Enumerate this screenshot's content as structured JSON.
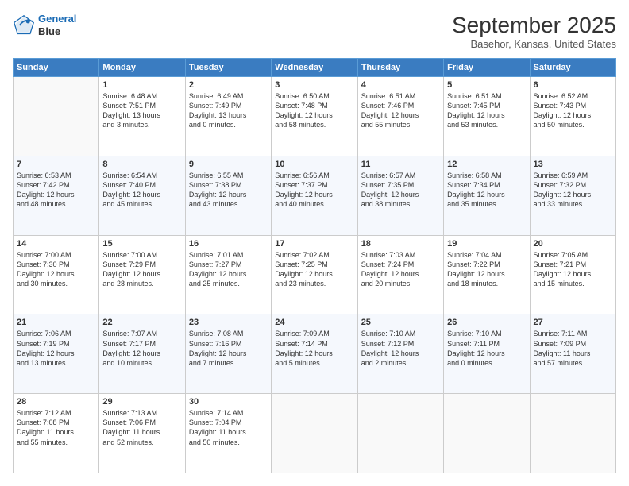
{
  "app": {
    "name": "GeneralBlue",
    "logo_line1": "General",
    "logo_line2": "Blue"
  },
  "header": {
    "month": "September 2025",
    "location": "Basehor, Kansas, United States"
  },
  "weekdays": [
    "Sunday",
    "Monday",
    "Tuesday",
    "Wednesday",
    "Thursday",
    "Friday",
    "Saturday"
  ],
  "weeks": [
    [
      {
        "day": "",
        "sunrise": "",
        "sunset": "",
        "daylight": ""
      },
      {
        "day": "1",
        "sunrise": "Sunrise: 6:48 AM",
        "sunset": "Sunset: 7:51 PM",
        "daylight": "Daylight: 13 hours and 3 minutes."
      },
      {
        "day": "2",
        "sunrise": "Sunrise: 6:49 AM",
        "sunset": "Sunset: 7:49 PM",
        "daylight": "Daylight: 13 hours and 0 minutes."
      },
      {
        "day": "3",
        "sunrise": "Sunrise: 6:50 AM",
        "sunset": "Sunset: 7:48 PM",
        "daylight": "Daylight: 12 hours and 58 minutes."
      },
      {
        "day": "4",
        "sunrise": "Sunrise: 6:51 AM",
        "sunset": "Sunset: 7:46 PM",
        "daylight": "Daylight: 12 hours and 55 minutes."
      },
      {
        "day": "5",
        "sunrise": "Sunrise: 6:51 AM",
        "sunset": "Sunset: 7:45 PM",
        "daylight": "Daylight: 12 hours and 53 minutes."
      },
      {
        "day": "6",
        "sunrise": "Sunrise: 6:52 AM",
        "sunset": "Sunset: 7:43 PM",
        "daylight": "Daylight: 12 hours and 50 minutes."
      }
    ],
    [
      {
        "day": "7",
        "sunrise": "Sunrise: 6:53 AM",
        "sunset": "Sunset: 7:42 PM",
        "daylight": "Daylight: 12 hours and 48 minutes."
      },
      {
        "day": "8",
        "sunrise": "Sunrise: 6:54 AM",
        "sunset": "Sunset: 7:40 PM",
        "daylight": "Daylight: 12 hours and 45 minutes."
      },
      {
        "day": "9",
        "sunrise": "Sunrise: 6:55 AM",
        "sunset": "Sunset: 7:38 PM",
        "daylight": "Daylight: 12 hours and 43 minutes."
      },
      {
        "day": "10",
        "sunrise": "Sunrise: 6:56 AM",
        "sunset": "Sunset: 7:37 PM",
        "daylight": "Daylight: 12 hours and 40 minutes."
      },
      {
        "day": "11",
        "sunrise": "Sunrise: 6:57 AM",
        "sunset": "Sunset: 7:35 PM",
        "daylight": "Daylight: 12 hours and 38 minutes."
      },
      {
        "day": "12",
        "sunrise": "Sunrise: 6:58 AM",
        "sunset": "Sunset: 7:34 PM",
        "daylight": "Daylight: 12 hours and 35 minutes."
      },
      {
        "day": "13",
        "sunrise": "Sunrise: 6:59 AM",
        "sunset": "Sunset: 7:32 PM",
        "daylight": "Daylight: 12 hours and 33 minutes."
      }
    ],
    [
      {
        "day": "14",
        "sunrise": "Sunrise: 7:00 AM",
        "sunset": "Sunset: 7:30 PM",
        "daylight": "Daylight: 12 hours and 30 minutes."
      },
      {
        "day": "15",
        "sunrise": "Sunrise: 7:00 AM",
        "sunset": "Sunset: 7:29 PM",
        "daylight": "Daylight: 12 hours and 28 minutes."
      },
      {
        "day": "16",
        "sunrise": "Sunrise: 7:01 AM",
        "sunset": "Sunset: 7:27 PM",
        "daylight": "Daylight: 12 hours and 25 minutes."
      },
      {
        "day": "17",
        "sunrise": "Sunrise: 7:02 AM",
        "sunset": "Sunset: 7:25 PM",
        "daylight": "Daylight: 12 hours and 23 minutes."
      },
      {
        "day": "18",
        "sunrise": "Sunrise: 7:03 AM",
        "sunset": "Sunset: 7:24 PM",
        "daylight": "Daylight: 12 hours and 20 minutes."
      },
      {
        "day": "19",
        "sunrise": "Sunrise: 7:04 AM",
        "sunset": "Sunset: 7:22 PM",
        "daylight": "Daylight: 12 hours and 18 minutes."
      },
      {
        "day": "20",
        "sunrise": "Sunrise: 7:05 AM",
        "sunset": "Sunset: 7:21 PM",
        "daylight": "Daylight: 12 hours and 15 minutes."
      }
    ],
    [
      {
        "day": "21",
        "sunrise": "Sunrise: 7:06 AM",
        "sunset": "Sunset: 7:19 PM",
        "daylight": "Daylight: 12 hours and 13 minutes."
      },
      {
        "day": "22",
        "sunrise": "Sunrise: 7:07 AM",
        "sunset": "Sunset: 7:17 PM",
        "daylight": "Daylight: 12 hours and 10 minutes."
      },
      {
        "day": "23",
        "sunrise": "Sunrise: 7:08 AM",
        "sunset": "Sunset: 7:16 PM",
        "daylight": "Daylight: 12 hours and 7 minutes."
      },
      {
        "day": "24",
        "sunrise": "Sunrise: 7:09 AM",
        "sunset": "Sunset: 7:14 PM",
        "daylight": "Daylight: 12 hours and 5 minutes."
      },
      {
        "day": "25",
        "sunrise": "Sunrise: 7:10 AM",
        "sunset": "Sunset: 7:12 PM",
        "daylight": "Daylight: 12 hours and 2 minutes."
      },
      {
        "day": "26",
        "sunrise": "Sunrise: 7:10 AM",
        "sunset": "Sunset: 7:11 PM",
        "daylight": "Daylight: 12 hours and 0 minutes."
      },
      {
        "day": "27",
        "sunrise": "Sunrise: 7:11 AM",
        "sunset": "Sunset: 7:09 PM",
        "daylight": "Daylight: 11 hours and 57 minutes."
      }
    ],
    [
      {
        "day": "28",
        "sunrise": "Sunrise: 7:12 AM",
        "sunset": "Sunset: 7:08 PM",
        "daylight": "Daylight: 11 hours and 55 minutes."
      },
      {
        "day": "29",
        "sunrise": "Sunrise: 7:13 AM",
        "sunset": "Sunset: 7:06 PM",
        "daylight": "Daylight: 11 hours and 52 minutes."
      },
      {
        "day": "30",
        "sunrise": "Sunrise: 7:14 AM",
        "sunset": "Sunset: 7:04 PM",
        "daylight": "Daylight: 11 hours and 50 minutes."
      },
      {
        "day": "",
        "sunrise": "",
        "sunset": "",
        "daylight": ""
      },
      {
        "day": "",
        "sunrise": "",
        "sunset": "",
        "daylight": ""
      },
      {
        "day": "",
        "sunrise": "",
        "sunset": "",
        "daylight": ""
      },
      {
        "day": "",
        "sunrise": "",
        "sunset": "",
        "daylight": ""
      }
    ]
  ]
}
